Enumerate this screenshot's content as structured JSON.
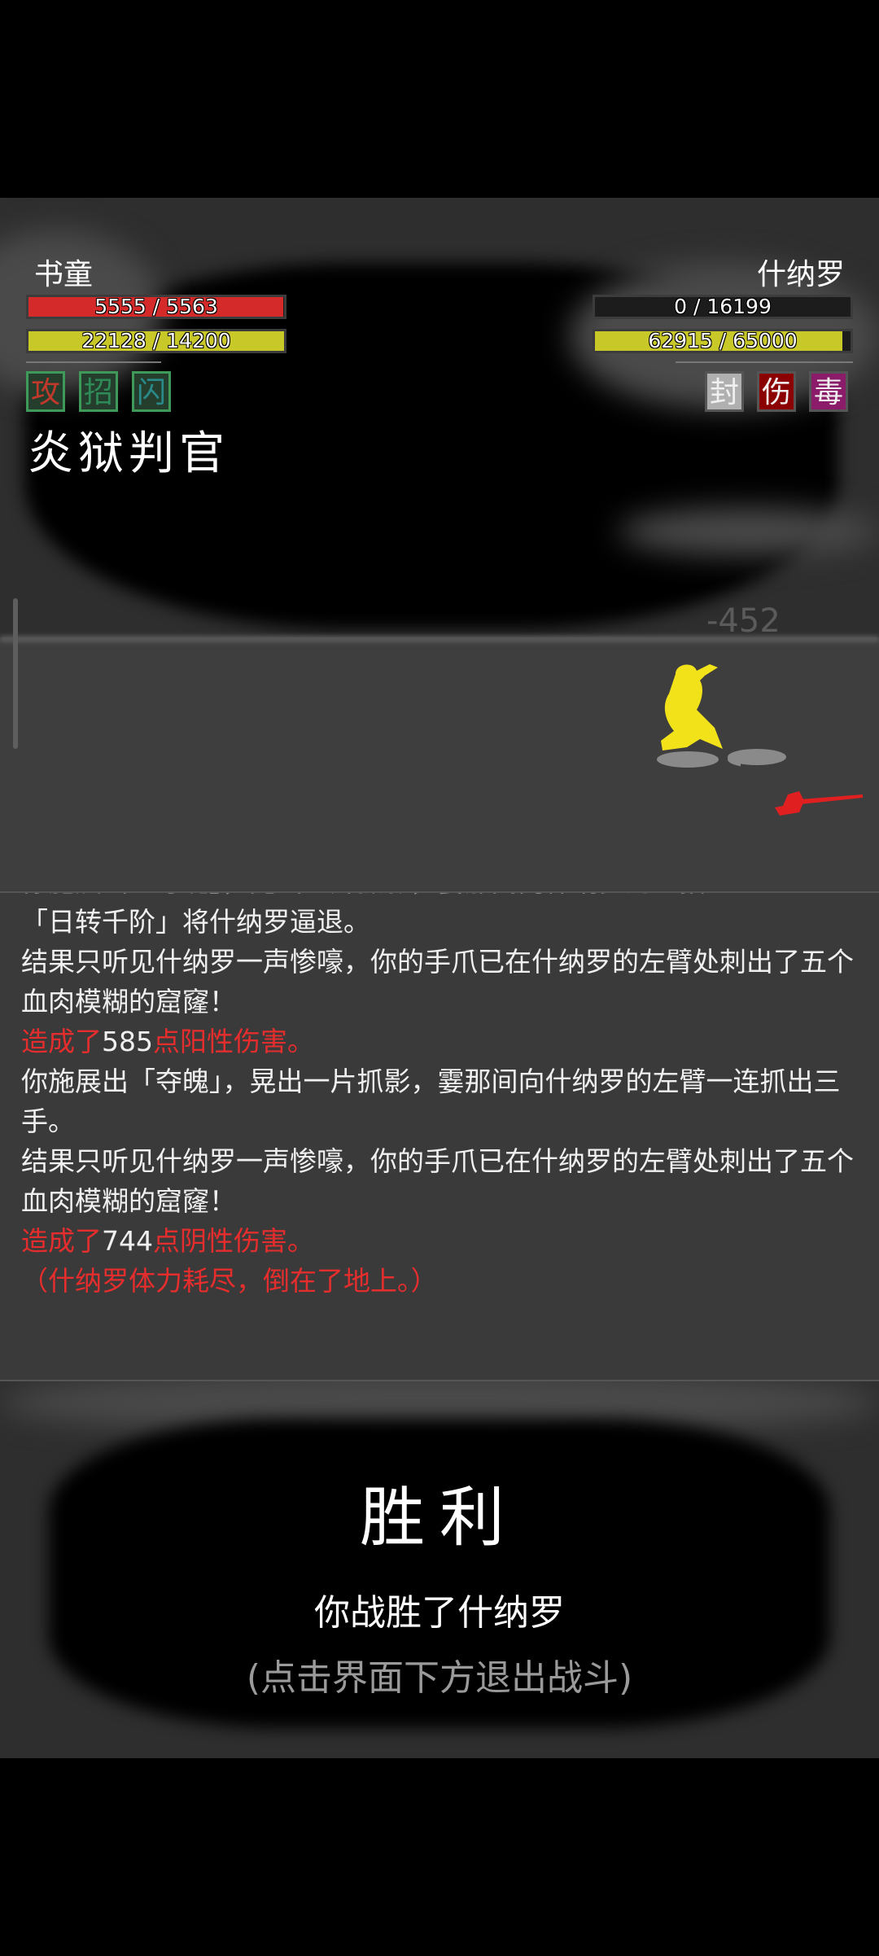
{
  "player": {
    "name": "书童",
    "hp": "5555 / 5563",
    "hp_fraction": 0.998,
    "energy": "22128 / 14200",
    "energy_fraction": 1.0,
    "buffs": [
      "攻",
      "招",
      "闪"
    ],
    "skill": "炎狱判官"
  },
  "enemy": {
    "name": "什纳罗",
    "hp": "0 / 16199",
    "hp_fraction": 0.0,
    "energy": "62915 / 65000",
    "energy_fraction": 0.968,
    "debuffs": [
      "封",
      "伤",
      "毒"
    ]
  },
  "floating_damage": "-452",
  "log": [
    {
      "parts": [
        {
          "t": "你施展出「夺魄」，晃出一片抓影，霎那间向什纳罗的一招",
          "c": "faded"
        }
      ]
    },
    {
      "parts": [
        {
          "t": "「日转千阶」将什纳罗逼退。",
          "c": "white"
        }
      ]
    },
    {
      "parts": [
        {
          "t": "结果只听见什纳罗一声惨嚎，你的手爪已在什纳罗的左臂处刺出了五个血肉模糊的窟窿！",
          "c": "white"
        }
      ]
    },
    {
      "parts": [
        {
          "t": "造成了",
          "c": "red"
        },
        {
          "t": "585",
          "c": "white"
        },
        {
          "t": "点阳性伤害。",
          "c": "red"
        }
      ]
    },
    {
      "parts": [
        {
          "t": "你施展出「夺魄」，晃出一片抓影，霎那间向什纳罗的左臂一连抓出三手。",
          "c": "white"
        }
      ]
    },
    {
      "parts": [
        {
          "t": "结果只听见什纳罗一声惨嚎，你的手爪已在什纳罗的左臂处刺出了五个血肉模糊的窟窿！",
          "c": "white"
        }
      ]
    },
    {
      "parts": [
        {
          "t": "造成了",
          "c": "red"
        },
        {
          "t": "744",
          "c": "white"
        },
        {
          "t": "点阴性伤害。",
          "c": "red"
        }
      ]
    },
    {
      "parts": [
        {
          "t": "（什纳罗体力耗尽，倒在了地上。）",
          "c": "red"
        }
      ]
    }
  ],
  "victory": {
    "title": "胜利",
    "message": "你战胜了什纳罗",
    "hint": "(点击界面下方退出战斗)"
  },
  "colors": {
    "hp_red": "#d42a2a",
    "energy_yellow": "#c8c828",
    "enemy_hp_gray": "#8a8a8a",
    "buff_attack": "#c0392b",
    "buff_move": "#2e8b57",
    "buff_dodge": "#2a8a8a",
    "debuff_seal": "#b0b0b0",
    "debuff_wound": "#8b0000",
    "debuff_poison": "#8a1c6a",
    "character_yellow": "#f2e21a",
    "weapon_red": "#e02020"
  }
}
